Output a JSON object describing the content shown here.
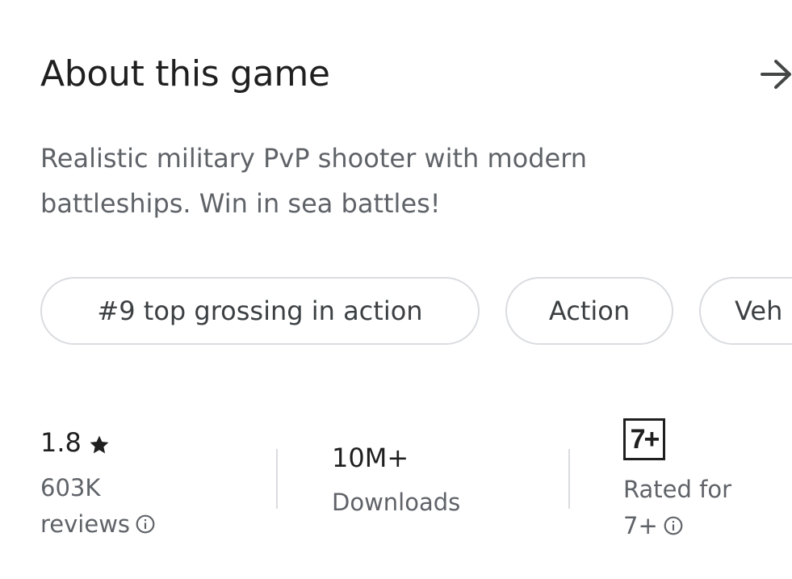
{
  "header": {
    "title": "About this game",
    "arrow_icon": "arrow-right-icon"
  },
  "description": {
    "line1": "Realistic military PvP shooter with modern",
    "line2": "battleships. Win in sea battles!"
  },
  "chips": [
    {
      "label": "#9 top grossing in action"
    },
    {
      "label": "Action"
    },
    {
      "label": "Veh"
    }
  ],
  "stats": {
    "rating": {
      "value": "1.8",
      "icon": "star-icon",
      "sub_line1": "603K",
      "sub_line2": "reviews",
      "info_icon": "info-icon"
    },
    "downloads": {
      "value": "10M+",
      "label": "Downloads"
    },
    "age": {
      "badge": "7+",
      "sub_line1": "Rated for",
      "sub_line2": "7+",
      "info_icon": "info-icon"
    }
  },
  "colors": {
    "primary_text": "#1f1f1f",
    "secondary_text": "#5f6368",
    "chip_border": "#dadce0",
    "chip_text": "#3c4043"
  }
}
